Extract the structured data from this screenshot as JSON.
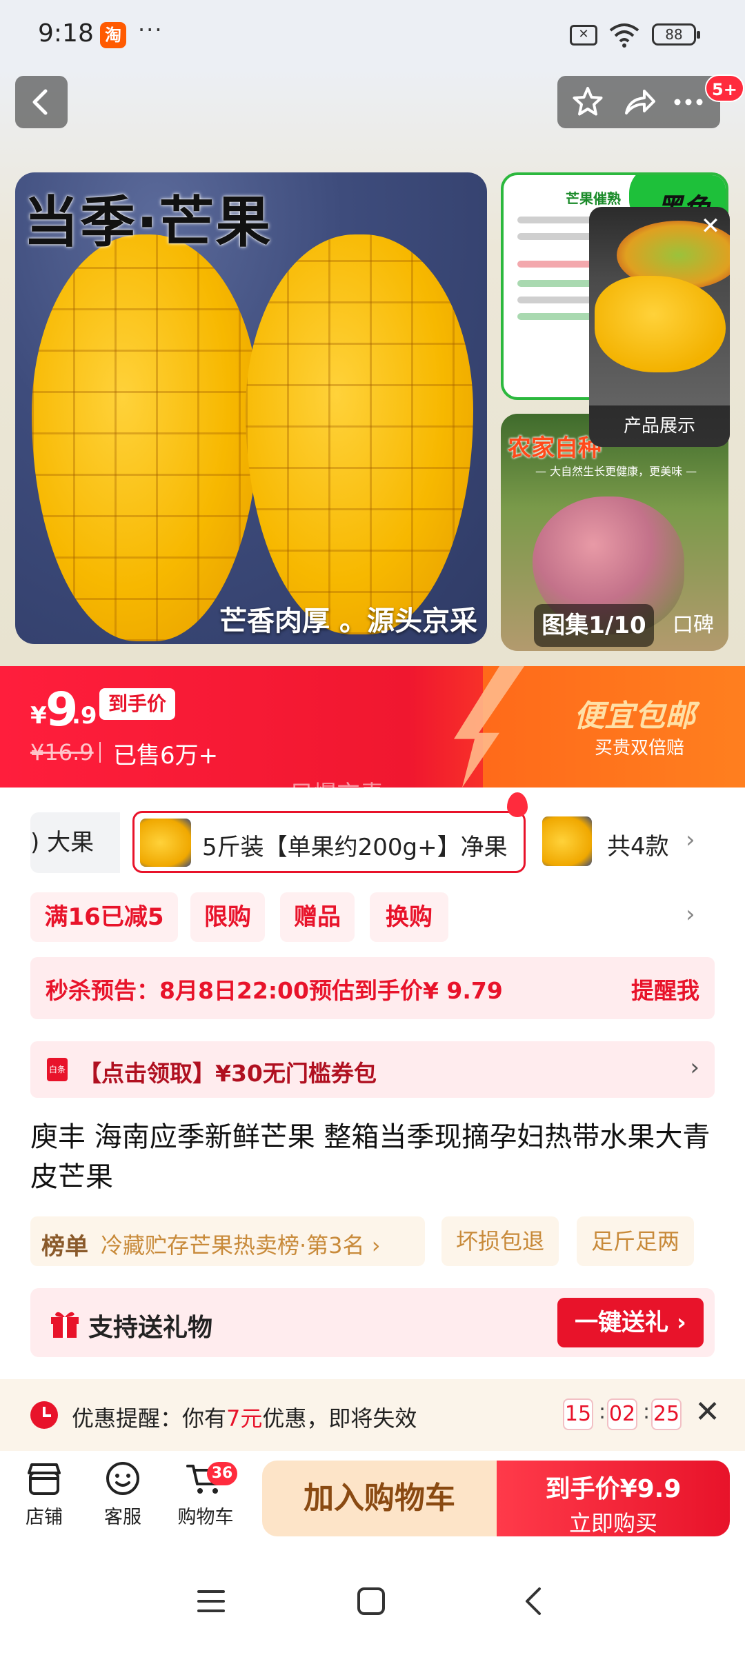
{
  "status_bar": {
    "time": "9:18",
    "app_badge": "淘",
    "more": "···",
    "battery": "88",
    "sim_icon": "sim-off-icon",
    "wifi_icon": "wifi-icon"
  },
  "top_actions": {
    "back_icon": "back-arrow-icon",
    "favorite_icon": "star-icon",
    "share_icon": "share-icon",
    "more_icon": "more-dots-icon",
    "message_badge": "5+"
  },
  "gallery": {
    "main_title": "当季·芒果",
    "main_caption": "芒香肉厚 。源头京采",
    "thumb_top_title": "芒果催熟",
    "thumb_top_corner": "黑色",
    "thumb_bottom_title": "农家自种",
    "thumb_bottom_sub": "— 大自然生长更健康，更美味 —",
    "counter": "图集1/10",
    "review_tab": "口碑",
    "video_label": "产品展示",
    "video_close": "✕"
  },
  "price": {
    "currency": "¥",
    "integer": "9",
    "decimal": ".9",
    "final_tag": "到手价",
    "original": "¥16.9",
    "sold": "已售6万+",
    "promo_title": "便宜包邮",
    "promo_sub": "买贵双倍赔",
    "watermark": "只爆京青"
  },
  "sku": {
    "prev_option": ") 大果",
    "selected_option": "5斤装【单果约200g+】净果",
    "total": "共4款",
    "arrow": "›"
  },
  "promo_tags": [
    "满16已减5",
    "限购",
    "赠品",
    "换购"
  ],
  "promo_arrow": "›",
  "flash_sale": {
    "text": "秒杀预告：8月8日22:00预估到手价¥ 9.79",
    "action": "提醒我"
  },
  "coupon": {
    "icon_text": "白条",
    "text": "【点击领取】¥30无门槛券包",
    "arrow": "›"
  },
  "product_title": "庾丰 海南应季新鲜芒果 整箱当季现摘孕妇热带水果大青 皮芒果",
  "ranking": {
    "badge": "榜单",
    "text": "冷藏贮存芒果热卖榜·第3名 ›"
  },
  "service_tags": [
    "坏损包退",
    "足斤足两"
  ],
  "gift": {
    "icon": "gift-icon",
    "text": "支持送礼物",
    "button": "一键送礼 ›"
  },
  "reminder": {
    "prefix": "优惠提醒：你有",
    "amount": "7元",
    "suffix": "优惠，即将失效",
    "countdown": [
      "15",
      "02",
      "25"
    ],
    "separator": ":",
    "close": "✕"
  },
  "bottom_bar": {
    "shop_label": "店铺",
    "service_label": "客服",
    "cart_label": "购物车",
    "cart_count": "36",
    "add_to_cart": "加入购物车",
    "buy_price": "到手价¥9.9",
    "buy_label": "立即购买"
  },
  "colors": {
    "accent_red": "#e8132a",
    "promo_orange": "#ff7a1a",
    "gold_text": "#c88a3a"
  }
}
